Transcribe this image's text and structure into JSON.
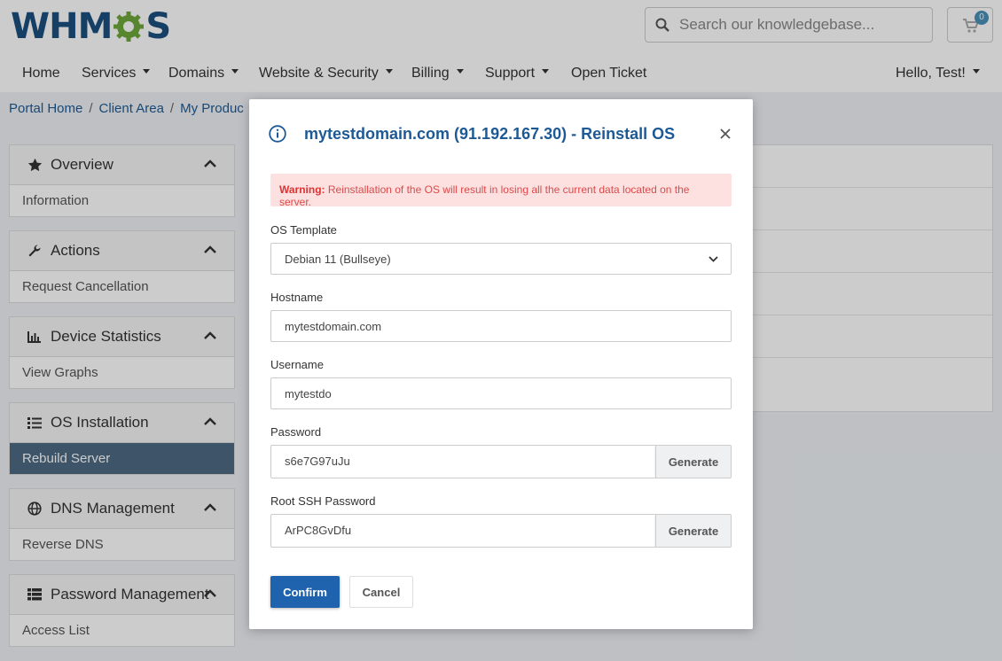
{
  "header": {
    "logo_left": "WHM",
    "logo_right": "S",
    "search": {
      "placeholder": "Search our knowledgebase..."
    },
    "cart": {
      "count": "0"
    }
  },
  "nav": {
    "items": [
      "Home",
      "Services",
      "Domains",
      "Website & Security",
      "Billing",
      "Support",
      "Open Ticket"
    ],
    "user": "Hello, Test!"
  },
  "breadcrumb": [
    "Portal Home",
    "Client Area",
    "My Produc"
  ],
  "sidebar": {
    "panels": [
      {
        "title": "Overview",
        "icon": "star-icon",
        "item": "Information"
      },
      {
        "title": "Actions",
        "icon": "wrench-icon",
        "item": "Request Cancellation"
      },
      {
        "title": "Device Statistics",
        "icon": "bar-chart-icon",
        "item": "View Graphs"
      },
      {
        "title": "OS Installation",
        "icon": "list-icon",
        "item": "Rebuild Server"
      },
      {
        "title": "DNS Management",
        "icon": "globe-icon",
        "item": "Reverse DNS"
      },
      {
        "title": "Password Management",
        "icon": "table-icon",
        "item": "Access List"
      }
    ]
  },
  "modal": {
    "title": "mytestdomain.com (91.192.167.30) - Reinstall OS",
    "warning_label": "Warning:",
    "warning_text": " Reinstallation of the OS will result in losing all the current data located on the server.",
    "os_template": {
      "label": "OS Template",
      "value": "Debian 11 (Bullseye)"
    },
    "hostname": {
      "label": "Hostname",
      "value": "mytestdomain.com"
    },
    "username": {
      "label": "Username",
      "value": "mytestdo"
    },
    "password": {
      "label": "Password",
      "value": "s6e7G97uJu",
      "button": "Generate"
    },
    "root_password": {
      "label": "Root SSH Password",
      "value": "ArPC8GvDfu",
      "button": "Generate"
    },
    "confirm": "Confirm",
    "cancel": "Cancel"
  },
  "colors": {
    "primary": "#1f62ad",
    "title": "#1d5a95",
    "warning_bg": "#fde1e1",
    "warning_text": "#dc4a4a"
  }
}
